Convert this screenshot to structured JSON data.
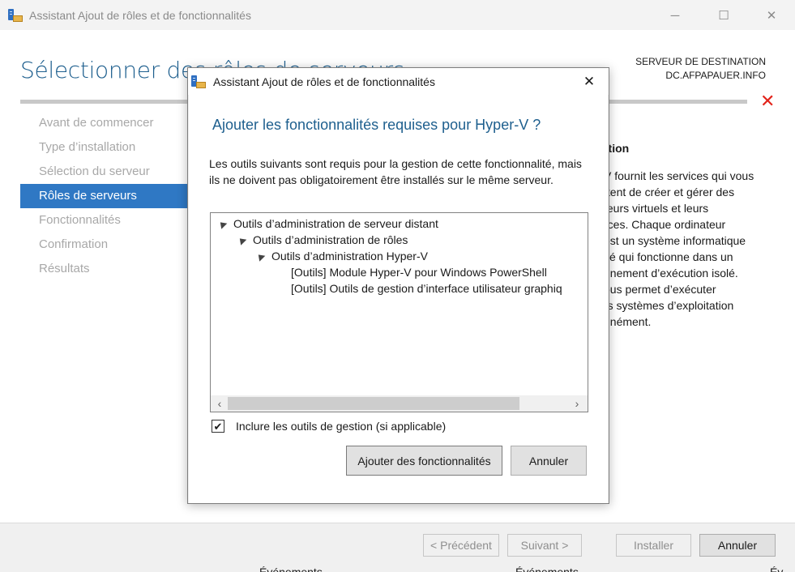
{
  "window": {
    "title": "Assistant Ajout de rôles et de fonctionnalités",
    "minimize": "─",
    "maximize": "☐",
    "close": "✕"
  },
  "page": {
    "title": "Sélectionner des rôles de serveurs",
    "destination_label": "SERVEUR DE DESTINATION",
    "destination_server": "DC.AFPAPAUER.INFO",
    "error_glyph": "✕"
  },
  "nav": {
    "items": [
      {
        "label": "Avant de commencer"
      },
      {
        "label": "Type d’installation"
      },
      {
        "label": "Sélection du serveur"
      },
      {
        "label": "Rôles de serveurs"
      },
      {
        "label": "Fonctionnalités"
      },
      {
        "label": "Confirmation"
      },
      {
        "label": "Résultats"
      }
    ],
    "active_index": 3
  },
  "description": {
    "heading": "ption",
    "lines": [
      "V fournit les services qui vous",
      "ttent de créer et gérer des",
      "teurs virtuels et leurs",
      "rces. Chaque ordinateur",
      "est un système informatique",
      "sé qui fonctionne dans un",
      "nnement d’exécution isolé.",
      "ous permet d’exécuter",
      "rs systèmes d’exploitation",
      "nnément."
    ]
  },
  "footer": {
    "prev": "< Précédent",
    "next": "Suivant >",
    "install": "Installer",
    "cancel": "Annuler",
    "peek": [
      "Événements",
      "Événements",
      "Év"
    ]
  },
  "dialog": {
    "title": "Assistant Ajout de rôles et de fonctionnalités",
    "close": "✕",
    "heading": "Ajouter les fonctionnalités requises pour Hyper-V ?",
    "description": "Les outils suivants sont requis pour la gestion de cette fonctionnalité, mais ils ne doivent pas obligatoirement être installés sur le même serveur.",
    "tree": [
      {
        "label": "Outils d’administration de serveur distant",
        "level": 0,
        "expanded": true
      },
      {
        "label": "Outils d’administration de rôles",
        "level": 1,
        "expanded": true
      },
      {
        "label": "Outils d’administration Hyper-V",
        "level": 2,
        "expanded": true
      },
      {
        "label": "[Outils] Module Hyper-V pour Windows PowerShell",
        "level": 3,
        "expanded": false
      },
      {
        "label": "[Outils] Outils de gestion d’interface utilisateur graphiq",
        "level": 3,
        "expanded": false
      }
    ],
    "scroll_left": "‹",
    "scroll_right": "›",
    "include_tools_label": "Inclure les outils de gestion (si applicable)",
    "include_tools_checked": true,
    "check_glyph": "✔",
    "add_button": "Ajouter des fonctionnalités",
    "cancel_button": "Annuler"
  }
}
